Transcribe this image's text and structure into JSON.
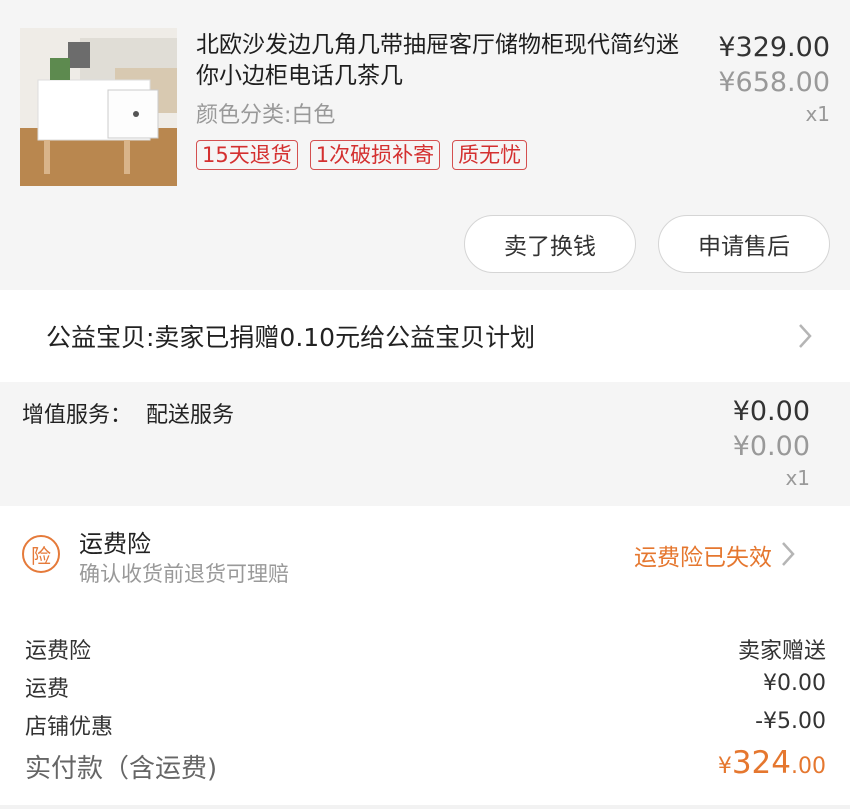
{
  "product": {
    "title": "北欧沙发边几角几带抽屉客厅储物柜现代简约迷你小边柜电话几茶几",
    "sku": "颜色分类:白色",
    "tags": [
      "15天退货",
      "1次破损补寄",
      "质无忧"
    ],
    "price": "¥329.00",
    "original_price": "¥658.00",
    "quantity": "x1",
    "buttons": {
      "sell": "卖了换钱",
      "after_sale": "申请售后"
    }
  },
  "charity": {
    "text": "公益宝贝:卖家已捐赠0.10元给公益宝贝计划"
  },
  "addon": {
    "label": "增值服务：  配送服务",
    "price": "¥0.00",
    "original_price": "¥0.00",
    "quantity": "x1"
  },
  "insurance": {
    "badge": "险",
    "title": "运费险",
    "subtitle": "确认收货前退货可理赔",
    "status": "运费险已失效"
  },
  "summary": {
    "rows": [
      {
        "label": "运费险",
        "value": "卖家赠送"
      },
      {
        "label": "运费",
        "value": "¥0.00"
      },
      {
        "label": "店铺优惠",
        "value": "-¥5.00"
      }
    ],
    "total_label": "实付款（含运费)",
    "total_currency": "¥",
    "total_integer": "324",
    "total_decimal": ".00"
  },
  "colors": {
    "accent_orange": "#e5772f",
    "tag_red": "#d43030",
    "panel_gray": "#f5f5f5"
  },
  "icons": [
    "chevron-right-icon",
    "insurance-badge-icon"
  ]
}
